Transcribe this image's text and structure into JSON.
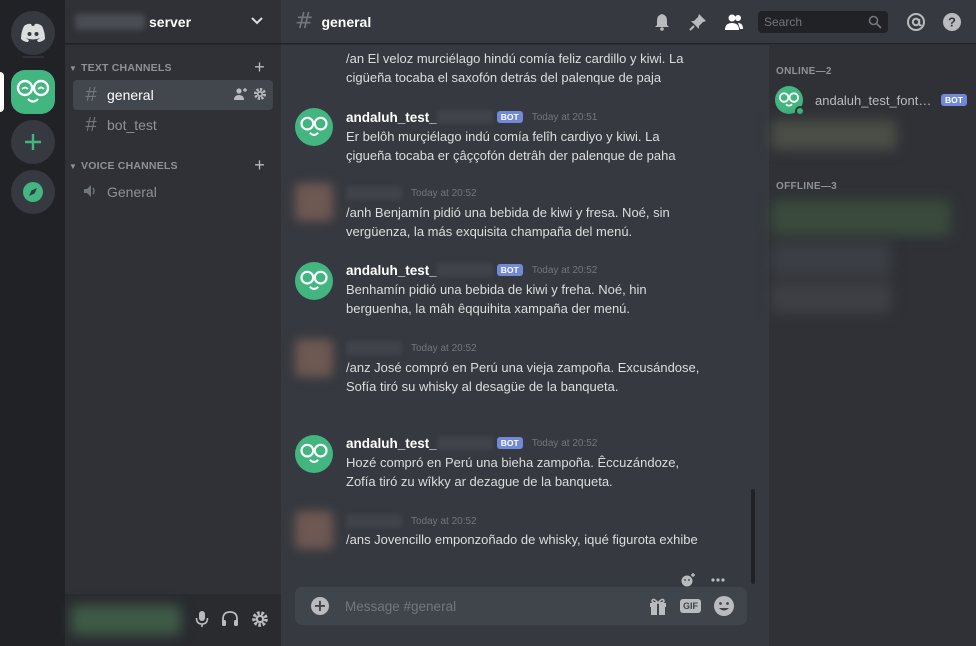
{
  "server": {
    "name": "server"
  },
  "sidebar": {
    "categories": {
      "text": "TEXT CHANNELS",
      "voice": "VOICE CHANNELS"
    },
    "text_channels": [
      {
        "label": "general"
      },
      {
        "label": "bot_test"
      }
    ],
    "voice_channels": [
      {
        "label": "General"
      }
    ]
  },
  "header": {
    "channel": "general",
    "search_placeholder": "Search"
  },
  "messages": [
    {
      "text": "/an El veloz murciélago hindú comía feliz cardillo y kiwi. La cigüeña tocaba el saxofón detrás del palenque de paja"
    },
    {
      "author": "andaluh_test_",
      "badge": "BOT",
      "time": "Today at 20:51",
      "text": "Er belôh murçiélago indú comía felîh cardiyo y kiwi. La çigueña tocaba er çâççofón detrâh der palenque de paha"
    },
    {
      "time": "Today at 20:52",
      "text": "/anh Benjamín pidió una bebida de kiwi y fresa. Noé, sin vergüenza, la más exquisita champaña del menú."
    },
    {
      "author": "andaluh_test_",
      "badge": "BOT",
      "time": "Today at 20:52",
      "text": "Benhamín pidió una bebida de kiwi y freha. Noé, hin berguenha, la mâh êqquihita xampaña der menú."
    },
    {
      "time": "Today at 20:52",
      "text": "/anz José compró en Perú una vieja zampoña. Excusándose, Sofía tiró su whisky al desagüe de la banqueta."
    },
    {
      "author": "andaluh_test_",
      "badge": "BOT",
      "time": "Today at 20:52",
      "text": "Hozé compró en Perú una bieha zampoña. Êccuzándoze, Zofía tiró zu wîkky ar dezague de la banqueta."
    },
    {
      "time": "Today at 20:52",
      "text": "/ans Jovencillo emponzoñado de whisky, iqué figurota exhibe"
    }
  ],
  "composer": {
    "placeholder": "Message #general",
    "gif_label": "GIF"
  },
  "members": {
    "online_header": "ONLINE—2",
    "offline_header": "OFFLINE—3",
    "online": [
      {
        "name": "andaluh_test_fontanero",
        "badge": "BOT"
      }
    ]
  },
  "colors": {
    "brand": "#7289da",
    "online": "#43b581",
    "bg": "#36393f",
    "sidebar": "#2f3136",
    "rail": "#202225"
  }
}
